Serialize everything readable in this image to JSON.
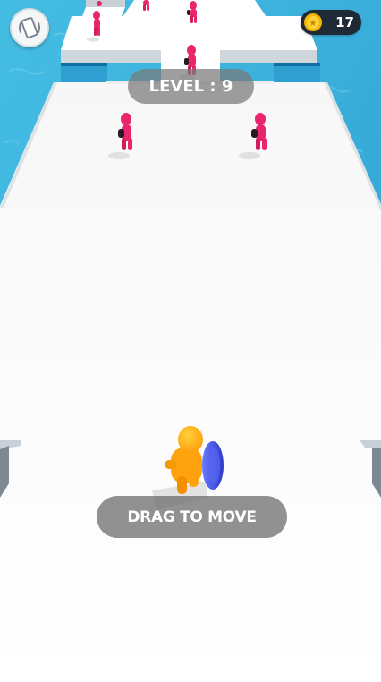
{
  "hud": {
    "vibration_toggle_icon": "phone-vibrate-icon",
    "coins": {
      "icon": "coin-icon",
      "count": "17"
    },
    "level_label": "LEVEL : 9",
    "hint_label": "DRAG TO MOVE"
  },
  "scene": {
    "enemies_visible": 7,
    "colors": {
      "water": "#3fb3dc",
      "platform": "#ffffff",
      "enemy": "#e8256d",
      "player": "#ffa20e",
      "shield": "#3f4fe6",
      "coin": "#f2b705",
      "panel": "#1f2a36"
    }
  }
}
